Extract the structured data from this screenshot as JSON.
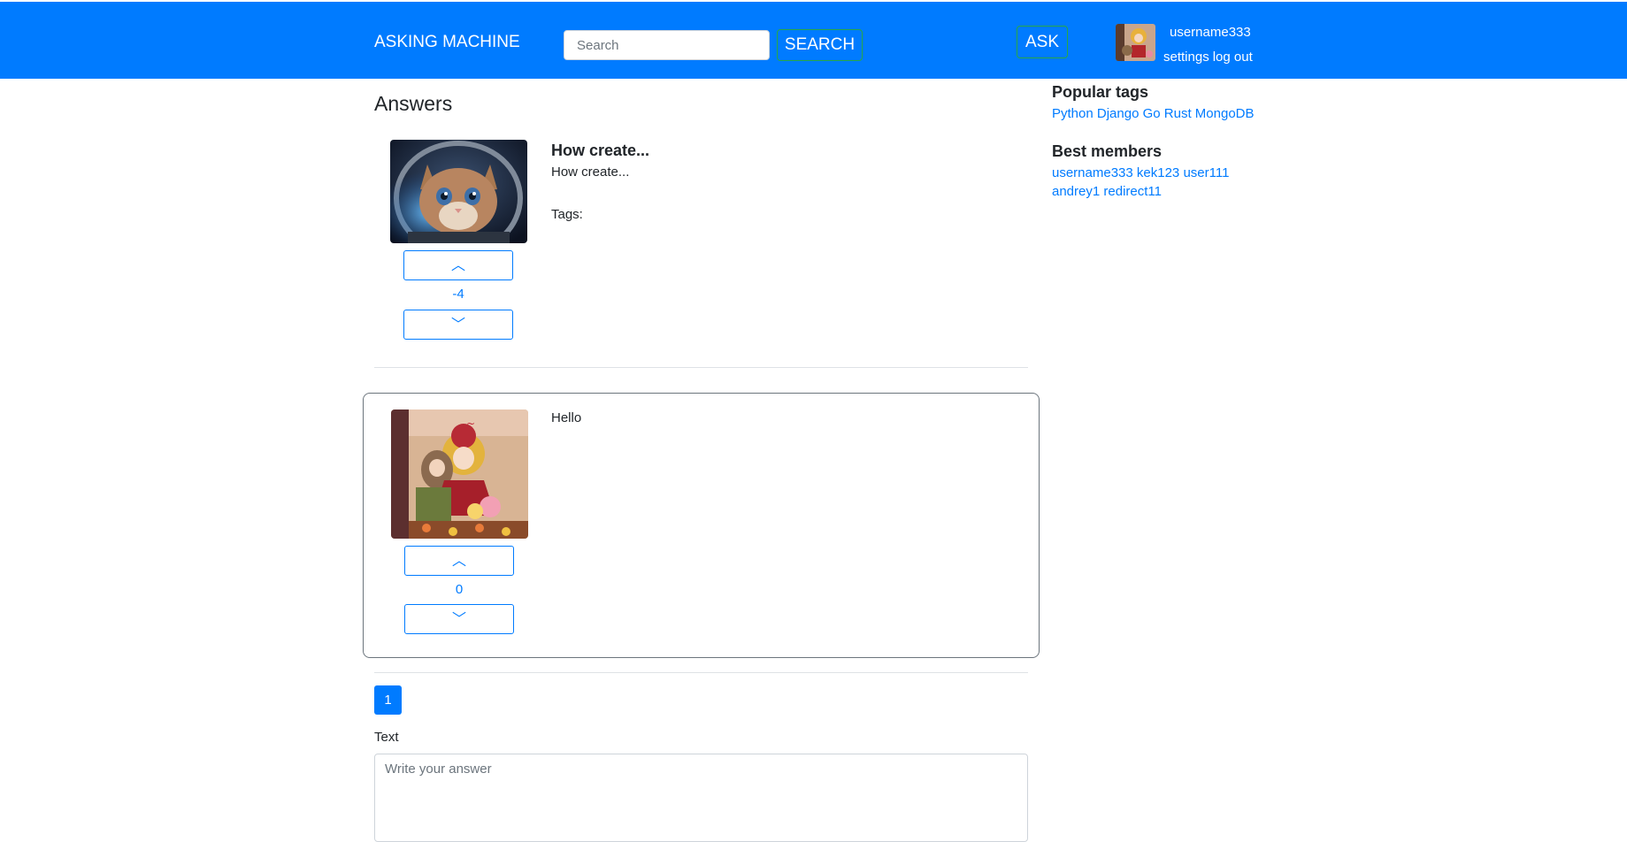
{
  "header": {
    "brand": "ASKING MACHINE",
    "search_placeholder": "Search",
    "search_button": "SEARCH",
    "ask_button": "ASK",
    "username": "username333",
    "settings_link": "settings",
    "logout_link": "log out"
  },
  "main": {
    "heading": "Answers",
    "question": {
      "title": "How create...",
      "body": "How create...",
      "tags_label": "Tags:",
      "vote_up": "︿",
      "vote_count": "-4",
      "vote_down": "﹀"
    },
    "answers": [
      {
        "body": "Hello",
        "vote_up": "︿",
        "vote_count": "0",
        "vote_down": "﹀"
      }
    ],
    "pagination": {
      "current": "1"
    },
    "form": {
      "label": "Text",
      "placeholder": "Write your answer"
    }
  },
  "sidebar": {
    "popular_tags_title": "Popular tags",
    "tags": [
      "Python",
      "Django",
      "Go",
      "Rust",
      "MongoDB"
    ],
    "best_members_title": "Best members",
    "members": [
      "username333",
      "kek123",
      "user111",
      "andrey1",
      "redirect11"
    ]
  },
  "colors": {
    "primary": "#007bff",
    "success_border": "#28a745",
    "card_border": "#6c757d"
  }
}
